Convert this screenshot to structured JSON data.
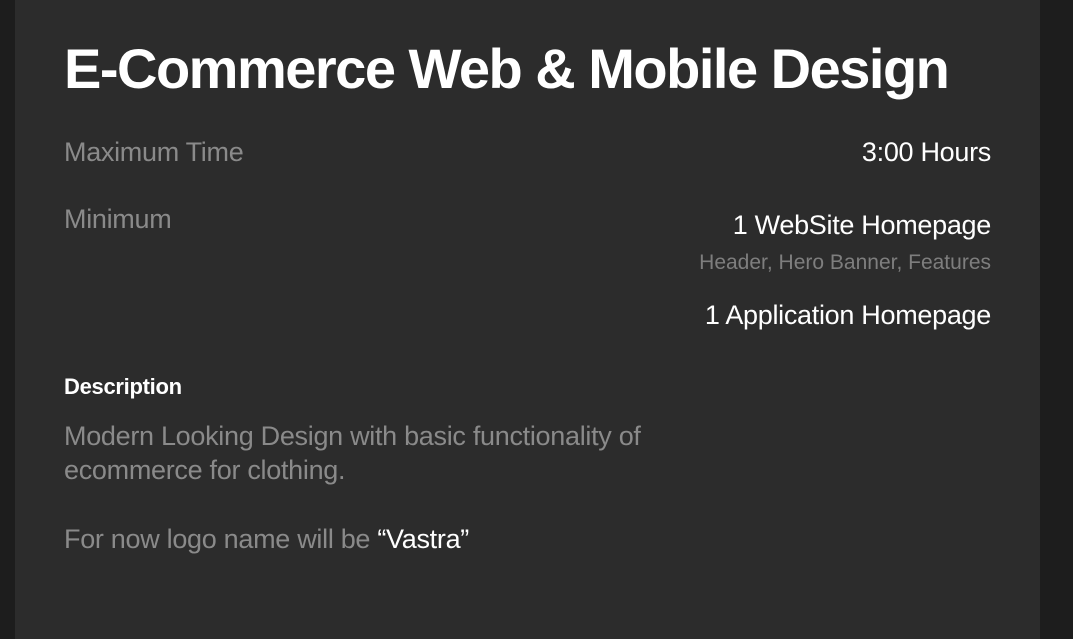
{
  "title": "E-Commerce Web & Mobile Design",
  "max_time": {
    "label": "Maximum Time",
    "value": "3:00 Hours"
  },
  "minimum": {
    "label": "Minimum",
    "items": [
      {
        "title": "1 WebSite Homepage",
        "detail": "Header, Hero Banner, Features"
      },
      {
        "title": "1 Application Homepage"
      }
    ]
  },
  "description": {
    "heading": "Description",
    "text": "Modern Looking Design with basic functionality of ecommerce for clothing.",
    "logo_prefix": "For now logo name will be ",
    "logo_name": "“Vastra”"
  },
  "colors": {
    "page_bg": "#1d1d1d",
    "card_bg": "#2c2c2c",
    "text_primary": "#ffffff",
    "text_muted": "#8a8a8a"
  }
}
